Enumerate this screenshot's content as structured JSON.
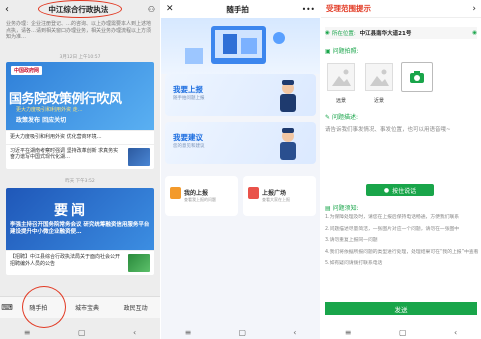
{
  "screen1": {
    "title": "中江综合行政执法",
    "notice": "业务办理：企业注册登记、…的咨询、以上办理需要本人到上述地点执，请各…请到相关窗口办理业务，相关业务办理流程以上方须知为准…",
    "stamp1": "3月12日 上午10:57",
    "news1": {
      "logo": "中国政府网",
      "headline": "国务院政策例行吹风",
      "subline": "更大力度吸引和利用外资   走…",
      "subline2": "政策发布 回应关切",
      "rows": [
        {
          "text": "更大力度吸引和利用外资 优化营商环境…"
        },
        {
          "text": "习近平在湖南考察时强调 坚持改革创新 求真务实 奋力谱写中国式现代化湖…"
        }
      ]
    },
    "stamp2": "昨天 下午3:52",
    "news2": {
      "headline": "要闻",
      "desc": "李强主持召开国务院常务会议 研究统筹融资信用服务平台建设提升中小微企业融资便…",
      "rows": [
        {
          "text": "【招聘】中江县综合行政执法局关于面向社会公开招聘编外人员的公告"
        }
      ]
    },
    "tabs": [
      "随手拍",
      "城市宝典",
      "政民互动"
    ]
  },
  "screen2": {
    "title": "随手拍",
    "report_title": "我要上报",
    "report_sub": "随手拍问题上报",
    "suggest_title": "我要建议",
    "suggest_sub": "您的意见和建议",
    "mine_title": "我的上报",
    "mine_sub": "查看我上报的问题",
    "square_title": "上报广场",
    "square_sub": "查看大家在上报"
  },
  "screen3": {
    "title": "受理范围提示",
    "location_label": "所在位置:",
    "location_value": "中江县南华大道21号",
    "photo_section": "问题拍照:",
    "photo_labels": [
      "远景",
      "近景"
    ],
    "desc_section": "问题描述:",
    "desc_placeholder": "请告诉我们事发情况、事发位置，也可以用语音哦~",
    "voice_button": "按住说话",
    "notes_title": "问题须知:",
    "notes": [
      "1.为保障处理及时，请您在上报后保持电话畅通，方便我们联系",
      "2.问题描述尽量简洁，一张图片对应一个问题，请勿在一张图中",
      "3.请勿重复上报同一问题",
      "4.我们将依据所报问题的类型进行处理，处理结果可在“我的上报”中查看",
      "5.如有疑问请拨打联系电话"
    ],
    "send_button": "发送"
  },
  "colors": {
    "red_circle": "#e23a24",
    "green": "#19a54a",
    "blue": "#1e6fe0"
  }
}
